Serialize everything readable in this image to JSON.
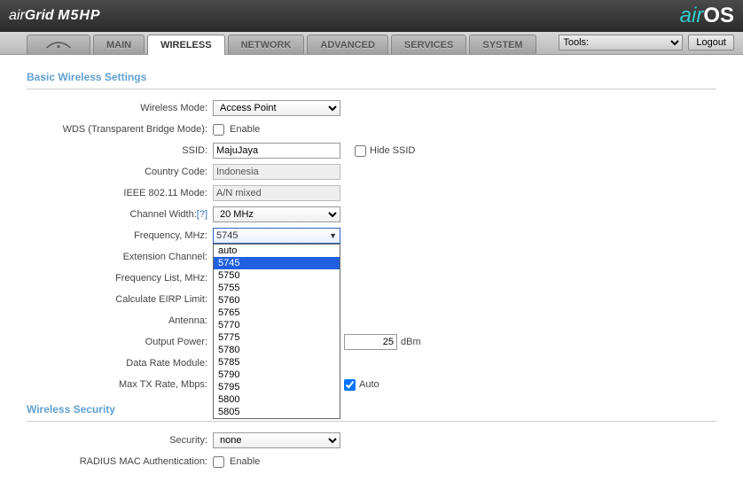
{
  "header": {
    "logo_left_air": "air",
    "logo_left_grid": "Grid",
    "logo_left_model": "M5HP",
    "logo_right_air": "air",
    "logo_right_os": "OS"
  },
  "nav": {
    "tabs": [
      "MAIN",
      "WIRELESS",
      "NETWORK",
      "ADVANCED",
      "SERVICES",
      "SYSTEM"
    ],
    "active": "WIRELESS",
    "tools_label": "Tools:",
    "logout": "Logout"
  },
  "sections": {
    "basic_title": "Basic Wireless Settings",
    "security_title": "Wireless Security"
  },
  "labels": {
    "wireless_mode": "Wireless Mode:",
    "wds": "WDS (Transparent Bridge Mode):",
    "ssid": "SSID:",
    "country": "Country Code:",
    "ieee": "IEEE 802.11 Mode:",
    "channel_width": "Channel Width:",
    "help_q": "[?]",
    "frequency": "Frequency, MHz:",
    "ext_channel": "Extension Channel:",
    "freq_list": "Frequency List, MHz:",
    "eirp": "Calculate EIRP Limit:",
    "antenna": "Antenna:",
    "output_power": "Output Power:",
    "data_rate": "Data Rate Module:",
    "max_tx": "Max TX Rate, Mbps:",
    "security": "Security:",
    "radius_mac": "RADIUS MAC Authentication:"
  },
  "values": {
    "wireless_mode": "Access Point",
    "enable": "Enable",
    "ssid": "MajuJaya",
    "hide_ssid": "Hide SSID",
    "country": "Indonesia",
    "ieee": "A/N mixed",
    "channel_width": "20 MHz",
    "frequency": "5745",
    "output_power": "25",
    "dbm": "dBm",
    "auto": "Auto",
    "security": "none"
  },
  "freq_options": [
    "auto",
    "5745",
    "5750",
    "5755",
    "5760",
    "5765",
    "5770",
    "5775",
    "5780",
    "5785",
    "5790",
    "5795",
    "5800",
    "5805"
  ],
  "freq_selected": "5745"
}
